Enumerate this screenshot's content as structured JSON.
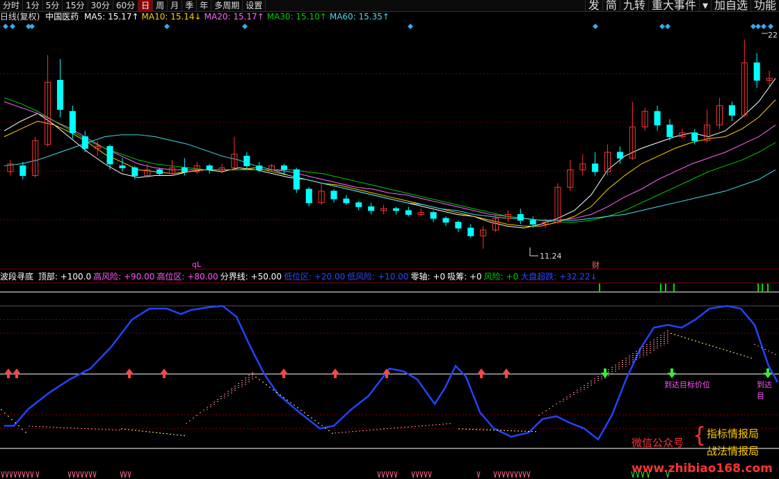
{
  "toolbar": {
    "left": [
      "分时",
      "1分",
      "5分",
      "15分",
      "30分",
      "60分",
      "日",
      "周",
      "月",
      "季",
      "年",
      "多周期",
      "设置"
    ],
    "active": "日",
    "right": [
      "发",
      "简",
      "九转",
      "重大事件",
      "▾",
      "加自选",
      "功能"
    ]
  },
  "header": {
    "period": "日线(复权)",
    "stock": "中国医药",
    "ma": [
      {
        "label": "MA5: 15.17↑",
        "color": "#ffffff"
      },
      {
        "label": "MA10: 15.14↓",
        "color": "#ffd000"
      },
      {
        "label": "MA20: 15.17↑",
        "color": "#ff66ff"
      },
      {
        "label": "MA30: 15.10↑",
        "color": "#00cc00"
      },
      {
        "label": "MA60: 15.35↑",
        "color": "#44ddee"
      }
    ]
  },
  "indicator": {
    "name": "波段寻底",
    "items": [
      {
        "label": "顶部: +100.0",
        "color": "#ffffff"
      },
      {
        "label": "高风险: +90.00",
        "color": "#ff55ff"
      },
      {
        "label": "高位区: +80.00",
        "color": "#ff55ff"
      },
      {
        "label": "分界线: +50.00",
        "color": "#ffffff"
      },
      {
        "label": "低位区: +20.00",
        "color": "#3344ff"
      },
      {
        "label": "低风险: +10.00",
        "color": "#3344ff"
      },
      {
        "label": "零轴: +0",
        "color": "#ffffff"
      },
      {
        "label": "吸筹: +0",
        "color": "#ffffff"
      },
      {
        "label": "风险: +0",
        "color": "#00cc00"
      },
      {
        "label": "大盘超跌: +32.22↓",
        "color": "#3344ff"
      }
    ],
    "signals": [
      "到达目标价位",
      "到达目"
    ]
  },
  "annotations": {
    "low": "11.24",
    "high": "22",
    "tag_ql": "qL",
    "tag_cai": "财"
  },
  "watermark": {
    "account": "微信公众号",
    "brand1": "指标情报局",
    "brand2": "战法情报局",
    "url": "www.zhibiao168.com"
  },
  "colors": {
    "up": "#ff3333",
    "down": "#00ffff",
    "blue": "#2244ff",
    "yellow": "#ffff66",
    "pink": "#ff8899",
    "green": "#00dd00"
  },
  "chart_data": {
    "type": "candlestick",
    "price_range": [
      10.8,
      22.6
    ],
    "low_label": 11.24,
    "high_label": 22,
    "ma": {
      "ma5": [
        17.3,
        17.8,
        18.2,
        17.6,
        16.9,
        16.2,
        15.6,
        15.1,
        14.9,
        15.0,
        15.0,
        15.2,
        15.3,
        15.2,
        15.4,
        15.3,
        15.1,
        14.9,
        14.8,
        14.6,
        14.4,
        14.2,
        14.0,
        13.8,
        13.6,
        13.4,
        13.2,
        13.0,
        12.9,
        12.6,
        12.4,
        12.3,
        12.5,
        12.8,
        13.2,
        14.0,
        15.3,
        16.0,
        16.4,
        16.7,
        17.0,
        17.2,
        17.0,
        17.3,
        18.0,
        18.8,
        20.0
      ],
      "ma10": [
        17.0,
        17.4,
        17.8,
        17.6,
        17.2,
        16.7,
        16.1,
        15.7,
        15.3,
        15.2,
        15.1,
        15.2,
        15.3,
        15.3,
        15.3,
        15.4,
        15.2,
        15.0,
        14.8,
        14.6,
        14.5,
        14.3,
        14.1,
        13.9,
        13.7,
        13.5,
        13.3,
        13.1,
        12.9,
        12.7,
        12.5,
        12.4,
        12.4,
        12.6,
        12.9,
        13.4,
        14.3,
        15.0,
        15.6,
        16.0,
        16.4,
        16.7,
        16.9,
        17.0,
        17.4,
        18.0,
        18.9
      ],
      "ma20": [
        18.8,
        18.5,
        18.2,
        17.8,
        17.4,
        16.9,
        16.4,
        16.0,
        15.6,
        15.4,
        15.3,
        15.3,
        15.3,
        15.3,
        15.3,
        15.3,
        15.3,
        15.2,
        15.0,
        14.8,
        14.6,
        14.4,
        14.3,
        14.1,
        14.0,
        13.8,
        13.6,
        13.4,
        13.2,
        13.0,
        12.9,
        12.8,
        12.7,
        12.7,
        12.8,
        13.0,
        13.4,
        13.9,
        14.3,
        14.8,
        15.2,
        15.6,
        15.9,
        16.2,
        16.6,
        17.0,
        17.6
      ],
      "ma30": [
        19.0,
        18.7,
        18.3,
        17.8,
        17.3,
        16.8,
        16.4,
        16.1,
        15.8,
        15.6,
        15.5,
        15.4,
        15.3,
        15.3,
        15.3,
        15.3,
        15.3,
        15.3,
        15.2,
        15.1,
        14.9,
        14.7,
        14.5,
        14.3,
        14.1,
        13.9,
        13.7,
        13.5,
        13.3,
        13.1,
        12.9,
        12.8,
        12.7,
        12.6,
        12.6,
        12.7,
        12.9,
        13.2,
        13.6,
        14.0,
        14.4,
        14.8,
        15.2,
        15.5,
        15.8,
        16.2,
        16.7
      ],
      "ma60": [
        15.5,
        15.6,
        15.8,
        16.1,
        16.4,
        16.7,
        17.0,
        17.1,
        17.1,
        17.0,
        16.8,
        16.6,
        16.3,
        16.0,
        15.8,
        15.5,
        15.3,
        15.0,
        14.8,
        14.6,
        14.4,
        14.2,
        14.0,
        13.8,
        13.6,
        13.5,
        13.3,
        13.2,
        13.0,
        12.9,
        12.8,
        12.8,
        12.7,
        12.7,
        12.7,
        12.8,
        12.9,
        13.0,
        13.2,
        13.4,
        13.6,
        13.8,
        14.0,
        14.2,
        14.5,
        14.8,
        15.3
      ]
    },
    "candles": [
      [
        15.2,
        15.6,
        15.0,
        15.8
      ],
      [
        15.5,
        15.0,
        14.8,
        15.7
      ],
      [
        15.0,
        16.8,
        14.9,
        17.0
      ],
      [
        16.6,
        19.8,
        16.5,
        21.2
      ],
      [
        19.9,
        18.4,
        18.0,
        21.0
      ],
      [
        18.3,
        17.2,
        16.9,
        18.6
      ],
      [
        17.0,
        16.4,
        16.2,
        17.3
      ],
      [
        16.4,
        16.5,
        16.0,
        16.8
      ],
      [
        16.5,
        15.6,
        15.3,
        16.6
      ],
      [
        15.5,
        15.4,
        15.2,
        15.9
      ],
      [
        15.4,
        15.0,
        14.8,
        15.5
      ],
      [
        15.0,
        15.3,
        14.9,
        15.6
      ],
      [
        15.3,
        15.1,
        15.0,
        15.4
      ],
      [
        15.1,
        15.4,
        15.0,
        15.8
      ],
      [
        15.4,
        15.2,
        15.0,
        15.9
      ],
      [
        15.2,
        15.5,
        15.1,
        15.7
      ],
      [
        15.5,
        15.3,
        15.1,
        15.6
      ],
      [
        15.3,
        15.4,
        15.1,
        15.6
      ],
      [
        15.4,
        16.1,
        15.3,
        17.0
      ],
      [
        16.0,
        15.5,
        15.3,
        16.2
      ],
      [
        15.5,
        15.3,
        15.2,
        15.7
      ],
      [
        15.3,
        15.5,
        15.2,
        15.6
      ],
      [
        15.5,
        15.3,
        15.1,
        15.6
      ],
      [
        15.3,
        14.3,
        14.1,
        15.4
      ],
      [
        14.3,
        13.6,
        13.4,
        14.4
      ],
      [
        13.6,
        14.2,
        13.5,
        14.6
      ],
      [
        14.2,
        13.8,
        13.6,
        14.3
      ],
      [
        13.8,
        13.6,
        13.5,
        14.0
      ],
      [
        13.6,
        13.4,
        13.2,
        13.7
      ],
      [
        13.4,
        13.2,
        13.0,
        13.6
      ],
      [
        13.2,
        13.3,
        13.0,
        13.5
      ],
      [
        13.3,
        13.2,
        13.0,
        13.4
      ],
      [
        13.2,
        13.0,
        12.9,
        13.4
      ],
      [
        13.0,
        13.1,
        12.9,
        13.3
      ],
      [
        13.1,
        12.8,
        12.6,
        13.2
      ],
      [
        12.8,
        12.6,
        12.4,
        12.9
      ],
      [
        12.6,
        12.3,
        12.1,
        12.7
      ],
      [
        12.3,
        11.9,
        11.8,
        12.5
      ],
      [
        11.9,
        12.2,
        11.24,
        12.4
      ],
      [
        12.2,
        12.8,
        12.1,
        13.0
      ],
      [
        12.8,
        13.0,
        12.6,
        13.2
      ],
      [
        13.0,
        12.7,
        12.5,
        13.3
      ],
      [
        12.7,
        12.5,
        12.3,
        12.9
      ],
      [
        12.5,
        12.6,
        12.3,
        12.8
      ],
      [
        12.6,
        14.4,
        12.5,
        14.6
      ],
      [
        14.4,
        15.3,
        14.2,
        15.8
      ],
      [
        15.3,
        15.6,
        15.0,
        16.1
      ],
      [
        15.6,
        15.2,
        15.0,
        16.2
      ],
      [
        15.2,
        16.2,
        15.0,
        16.6
      ],
      [
        16.2,
        15.9,
        15.6,
        16.5
      ],
      [
        15.9,
        17.5,
        15.8,
        18.8
      ],
      [
        17.5,
        18.3,
        17.3,
        18.5
      ],
      [
        18.3,
        17.6,
        17.3,
        18.6
      ],
      [
        17.6,
        17.0,
        16.8,
        17.9
      ],
      [
        17.0,
        17.2,
        16.9,
        17.4
      ],
      [
        17.2,
        16.8,
        16.6,
        17.4
      ],
      [
        16.8,
        17.6,
        16.7,
        18.4
      ],
      [
        17.6,
        18.6,
        17.4,
        19.0
      ],
      [
        18.6,
        18.1,
        17.8,
        18.8
      ],
      [
        18.1,
        20.8,
        18.0,
        22.0
      ],
      [
        20.8,
        19.9,
        19.5,
        21.3
      ],
      [
        19.9,
        20.0,
        19.6,
        20.4
      ]
    ]
  }
}
